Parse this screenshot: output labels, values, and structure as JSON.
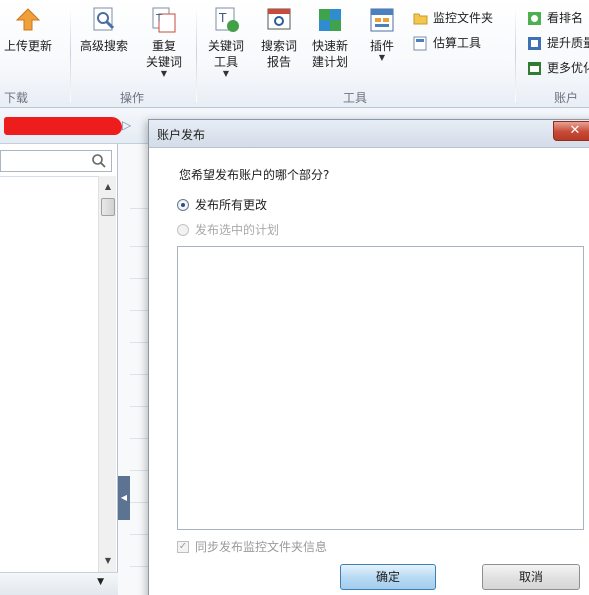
{
  "ribbon": {
    "upload_update": "上传更新",
    "advanced_search": "高级搜索",
    "duplicate_keywords": "重复\n关键词",
    "keyword_tool": "关键词\n工具",
    "search_term_report": "搜索词\n报告",
    "quick_new_plan": "快速新\n建计划",
    "plugins": "插件",
    "monitor_folder": "监控文件夹",
    "estimate_tool": "估算工具",
    "view_ranking": "看排名",
    "improve_quality": "提升质量",
    "more_optimization": "更多优化",
    "group_download": "下载",
    "group_operations": "操作",
    "group_tools": "工具",
    "group_account": "账户优"
  },
  "left": {
    "search_placeholder": ""
  },
  "dialog": {
    "title": "账户发布",
    "close_label": "✕",
    "question": "您希望发布账户的哪个部分?",
    "option_all": "发布所有更改",
    "option_selected": "发布选中的计划",
    "sync_checkbox": "同步发布监控文件夹信息",
    "ok": "确定",
    "cancel": "取消"
  },
  "colors": {
    "ribbon_bg": "#f7f9fc",
    "close_red": "#c74a36",
    "ok_blue": "#b9daf3",
    "redaction": "#ee1d1d"
  }
}
